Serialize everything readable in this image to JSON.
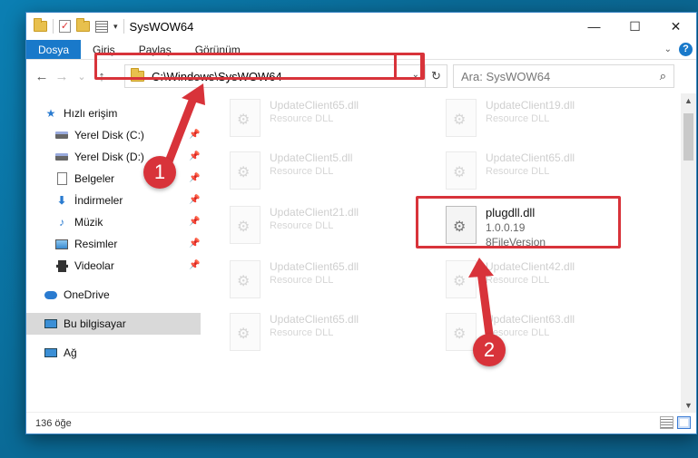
{
  "window": {
    "title": "SysWOW64"
  },
  "controls": {
    "minimize": "—",
    "maximize": "☐",
    "close": "✕"
  },
  "ribbon": {
    "tabs": [
      "Dosya",
      "Giriş",
      "Paylaş",
      "Görünüm"
    ]
  },
  "nav": {
    "back": "←",
    "forward": "→",
    "recent": "⌄",
    "up": "↑"
  },
  "address": {
    "path": "C:\\Windows\\SysWOW64"
  },
  "search": {
    "placeholder": "Ara: SysWOW64"
  },
  "sidebar": {
    "items": [
      {
        "label": "Hızlı erişim",
        "icon": "star-icon"
      },
      {
        "label": "Yerel Disk (C:)",
        "icon": "drive-icon",
        "pinned": true
      },
      {
        "label": "Yerel Disk (D:)",
        "icon": "drive-icon",
        "pinned": true
      },
      {
        "label": "Belgeler",
        "icon": "documents-icon",
        "pinned": true
      },
      {
        "label": "İndirmeler",
        "icon": "downloads-icon",
        "pinned": true
      },
      {
        "label": "Müzik",
        "icon": "music-icon",
        "pinned": true
      },
      {
        "label": "Resimler",
        "icon": "pictures-icon",
        "pinned": true
      },
      {
        "label": "Videolar",
        "icon": "videos-icon",
        "pinned": true
      },
      {
        "label": "OneDrive",
        "icon": "onedrive-icon"
      },
      {
        "label": "Bu bilgisayar",
        "icon": "computer-icon",
        "selected": true
      },
      {
        "label": "Ağ",
        "icon": "network-icon"
      }
    ]
  },
  "files": [
    {
      "name": "UpdateClient65.dll",
      "type": "Resource DLL"
    },
    {
      "name": "UpdateClient19.dll",
      "type": "Resource DLL"
    },
    {
      "name": "UpdateClient5.dll",
      "type": "Resource DLL"
    },
    {
      "name": "UpdateClient65.dll",
      "type": "Resource DLL"
    },
    {
      "name": "UpdateClient21.dll",
      "type": "Resource DLL"
    },
    {
      "name": "plugdll.dll",
      "type": "1.0.0.19",
      "desc": "8FileVersion",
      "selected": true
    },
    {
      "name": "UpdateClient65.dll",
      "type": "Resource DLL"
    },
    {
      "name": "UpdateClient42.dll",
      "type": "Resource DLL"
    },
    {
      "name": "UpdateClient65.dll",
      "type": "Resource DLL"
    },
    {
      "name": "UpdateClient63.dll",
      "type": "Resource DLL"
    }
  ],
  "status": {
    "count": "136 öğe"
  },
  "markers": {
    "one": "1",
    "two": "2"
  },
  "colors": {
    "accent": "#1979ca",
    "highlight": "#d8333a",
    "desktop": "#0b7fb3"
  }
}
